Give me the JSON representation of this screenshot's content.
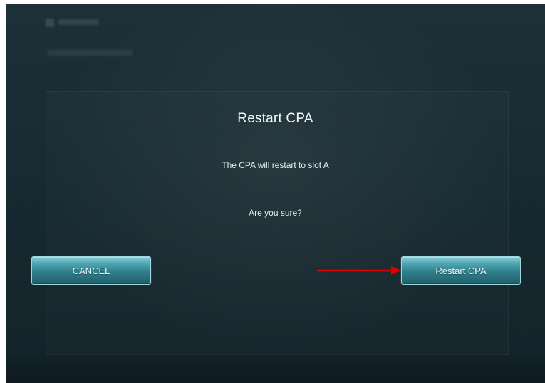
{
  "dialog": {
    "title": "Restart CPA",
    "message": "The CPA will restart to slot A",
    "confirmation": "Are you sure?",
    "buttons": {
      "cancel": "CANCEL",
      "confirm": "Restart CPA"
    }
  },
  "colors": {
    "background": "#182B32",
    "button_fill": "#2F7F8B",
    "button_border": "#9FD7DE",
    "text": "#F2F5F6",
    "arrow": "#E00000"
  },
  "icons": {
    "pointer": "red-arrow-icon"
  }
}
